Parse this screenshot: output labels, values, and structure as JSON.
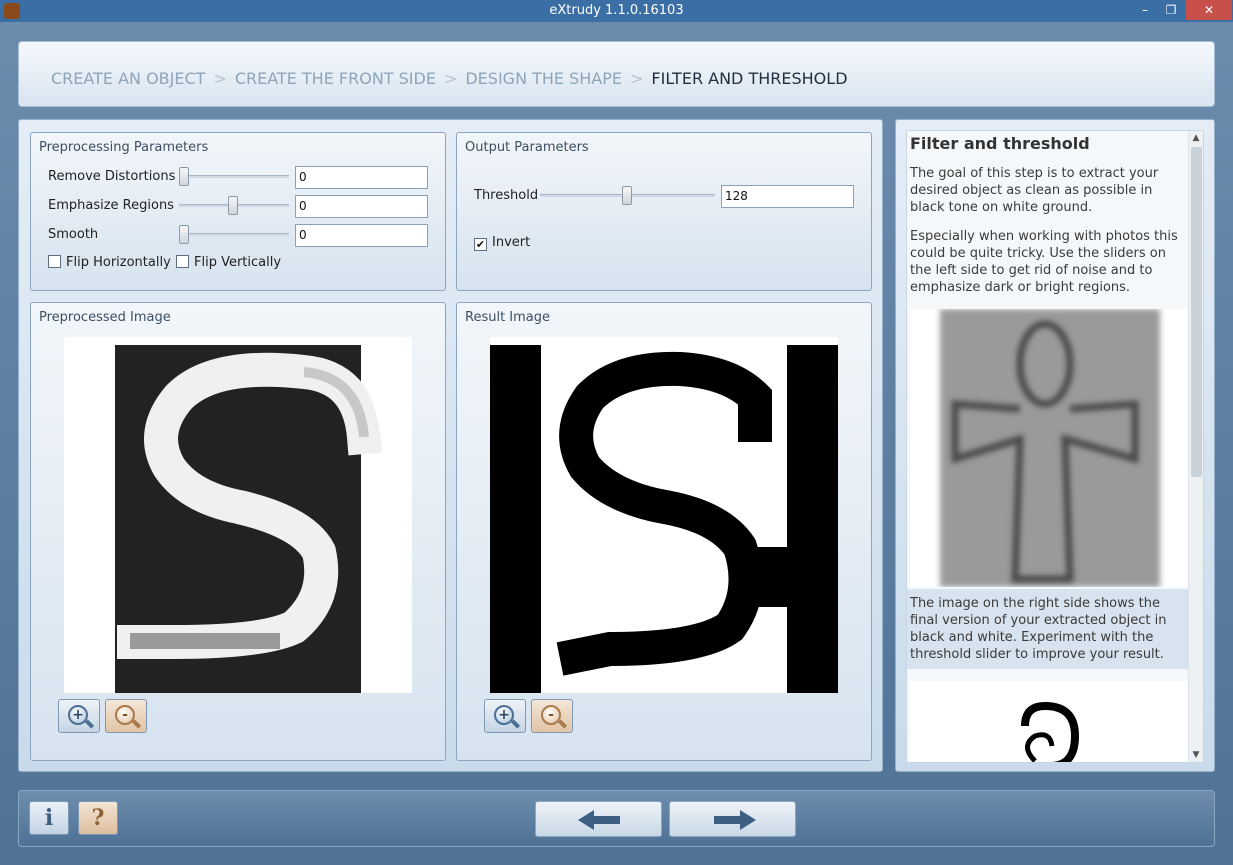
{
  "window": {
    "title": "eXtrudy 1.1.0.16103",
    "minimize": "–",
    "maximize": "❐",
    "close": "✕"
  },
  "breadcrumb": [
    {
      "label": "CREATE AN OBJECT"
    },
    {
      "label": "CREATE THE FRONT SIDE"
    },
    {
      "label": "DESIGN THE SHAPE"
    },
    {
      "label": "FILTER AND THRESHOLD"
    }
  ],
  "breadcrumb_sep": ">",
  "preprocessing": {
    "title": "Preprocessing Parameters",
    "remove_distortions": {
      "label": "Remove Distortions",
      "value": "0",
      "level": 0
    },
    "emphasize_regions": {
      "label": "Emphasize Regions",
      "value": "0",
      "level": 0.5
    },
    "smooth": {
      "label": "Smooth",
      "value": "0",
      "level": 0
    },
    "flip_horizontally": "Flip Horizontally",
    "flip_vertically": "Flip Vertically"
  },
  "output": {
    "title": "Output Parameters",
    "threshold": {
      "label": "Threshold",
      "value": "128",
      "level": 0.5
    },
    "invert": {
      "label": "Invert",
      "checked": true
    }
  },
  "preprocessed_image": {
    "title": "Preprocessed Image"
  },
  "result_image": {
    "title": "Result Image"
  },
  "help": {
    "title": "Filter and threshold",
    "p1": "The goal of this step is to extract your desired object as clean as possible in black tone on white ground.",
    "p2": "Especially when working with photos this could be quite tricky. Use the sliders on the left side to get rid of noise and to emphasize dark or bright regions.",
    "p3": "The image on the right side shows the final version of your extracted object in black and white. Experiment with the threshold slider to improve your result."
  },
  "bottom": {
    "info_label": "i",
    "help_label": "?"
  },
  "colors": {
    "accent": "#3a6ea5",
    "close_button": "#c7504a"
  }
}
